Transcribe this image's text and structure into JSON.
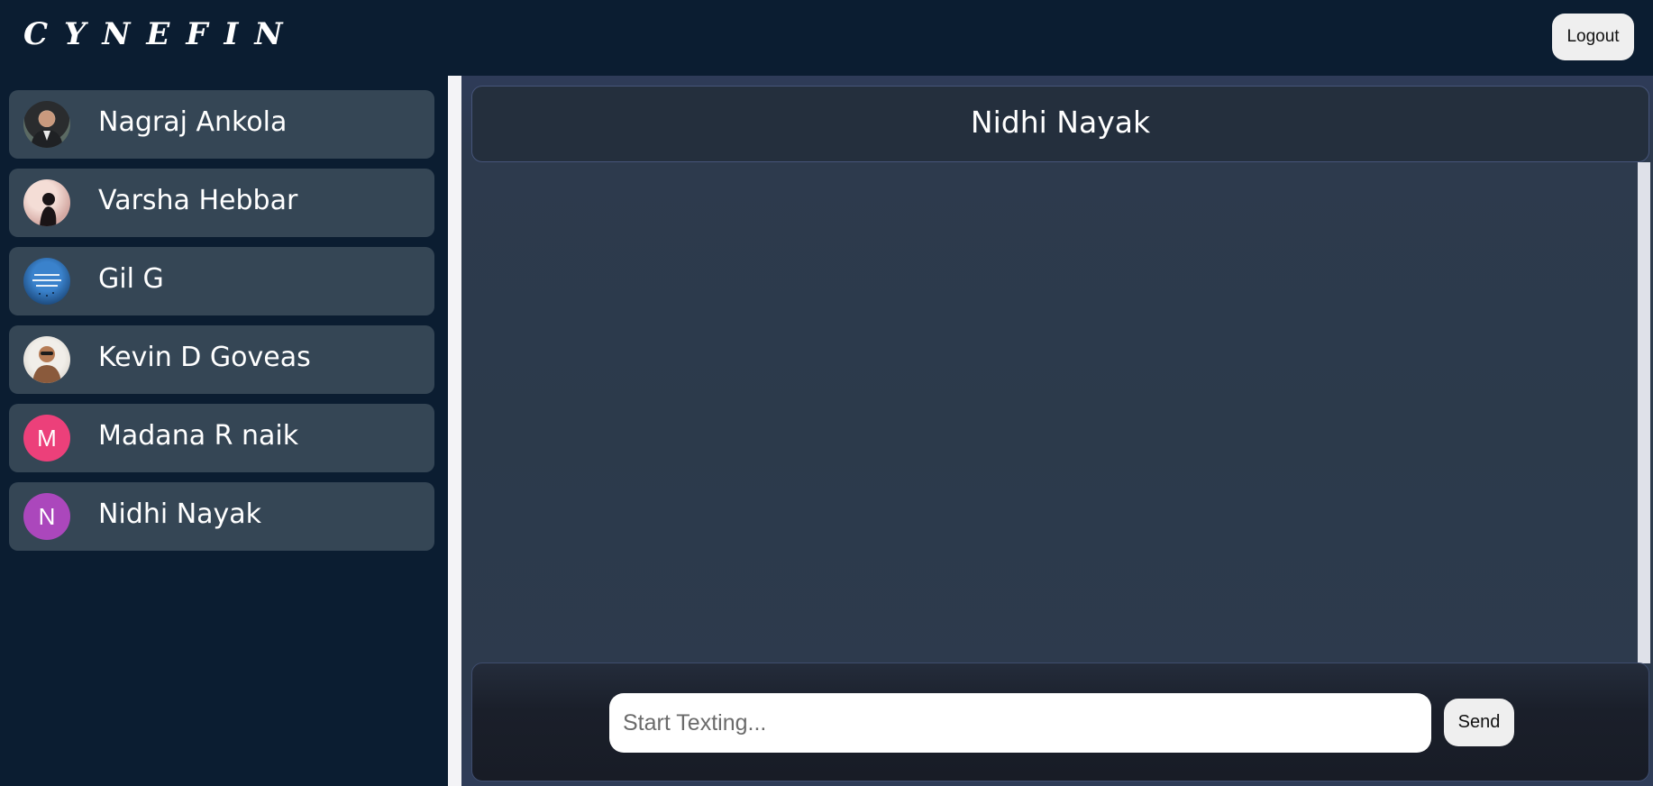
{
  "app": {
    "brand": "CYNEFIN",
    "logout_label": "Logout"
  },
  "contacts": [
    {
      "name": "Nagraj Ankola",
      "avatar_type": "photo",
      "avatar_colors": [
        "#5b6a63",
        "#2a2c2e"
      ]
    },
    {
      "name": "Varsha Hebbar",
      "avatar_type": "photo",
      "avatar_colors": [
        "#e8c9c2",
        "#1a1416"
      ]
    },
    {
      "name": "Gil G",
      "avatar_type": "photo",
      "avatar_colors": [
        "#2d6fb7",
        "#0c2b52"
      ]
    },
    {
      "name": "Kevin D Goveas",
      "avatar_type": "photo",
      "avatar_colors": [
        "#e6e2dc",
        "#8a5a3c"
      ]
    },
    {
      "name": "Madana R naik",
      "avatar_type": "initial",
      "initial": "M",
      "avatar_colors": [
        "#ec407a"
      ]
    },
    {
      "name": "Nidhi Nayak",
      "avatar_type": "initial",
      "initial": "N",
      "avatar_colors": [
        "#ab47bc"
      ]
    }
  ],
  "chat": {
    "title": "Nidhi Nayak",
    "input_placeholder": "Start Texting...",
    "input_value": "",
    "send_label": "Send"
  }
}
